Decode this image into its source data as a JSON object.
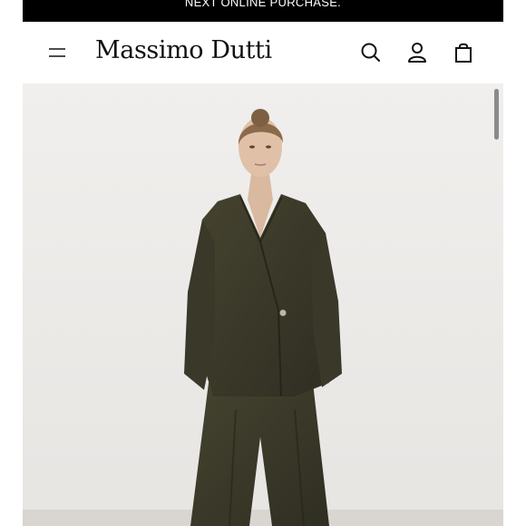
{
  "promo": {
    "text": "NEXT ONLINE PURCHASE."
  },
  "header": {
    "logo": "Massimo Dutti",
    "icons": [
      "menu-icon",
      "search-icon",
      "account-icon",
      "shopping-bag-icon"
    ]
  },
  "colors": {
    "promo_bg": "#000000",
    "header_bg": "#ffffff",
    "hero_bg": "#eeeceb",
    "garment": "#3c3a29"
  }
}
